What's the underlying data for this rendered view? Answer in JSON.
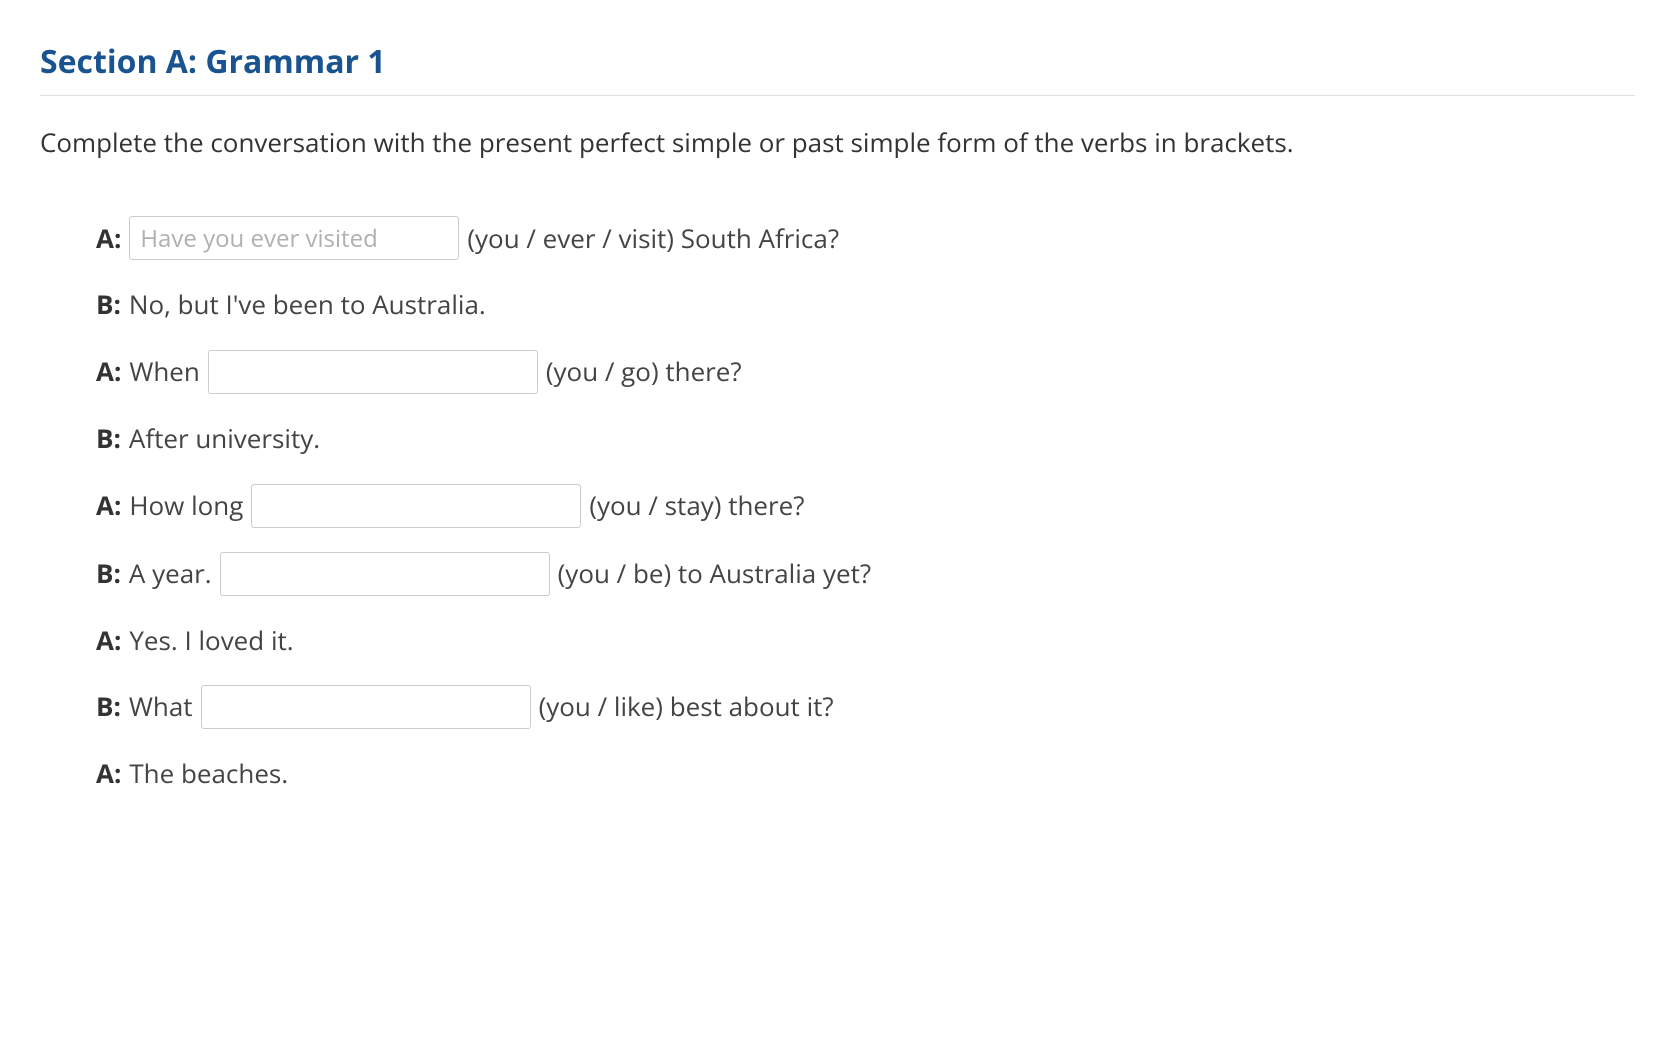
{
  "section_title": "Section A: Grammar 1",
  "instructions": "Complete the conversation with the present perfect simple or past simple form of the verbs in brackets.",
  "lines": [
    {
      "speaker": "A:",
      "pre_text": "",
      "input_value": "Have you ever visited",
      "post_text": "(you / ever / visit) South Africa?",
      "has_input": true,
      "input_filled": true
    },
    {
      "speaker": "B:",
      "pre_text": "No, but I've been to Australia.",
      "has_input": false
    },
    {
      "speaker": "A:",
      "pre_text": "When",
      "input_value": "",
      "post_text": "(you / go) there?",
      "has_input": true,
      "input_filled": false
    },
    {
      "speaker": "B:",
      "pre_text": "After university.",
      "has_input": false
    },
    {
      "speaker": "A:",
      "pre_text": "How long",
      "input_value": "",
      "post_text": "(you / stay) there?",
      "has_input": true,
      "input_filled": false
    },
    {
      "speaker": "B:",
      "pre_text": "A year.",
      "input_value": "",
      "post_text": "(you / be) to Australia yet?",
      "has_input": true,
      "input_filled": false
    },
    {
      "speaker": "A:",
      "pre_text": "Yes. I loved it.",
      "has_input": false
    },
    {
      "speaker": "B:",
      "pre_text": "What",
      "input_value": "",
      "post_text": "(you / like) best about it?",
      "has_input": true,
      "input_filled": false
    },
    {
      "speaker": "A:",
      "pre_text": "The beaches.",
      "has_input": false
    }
  ]
}
